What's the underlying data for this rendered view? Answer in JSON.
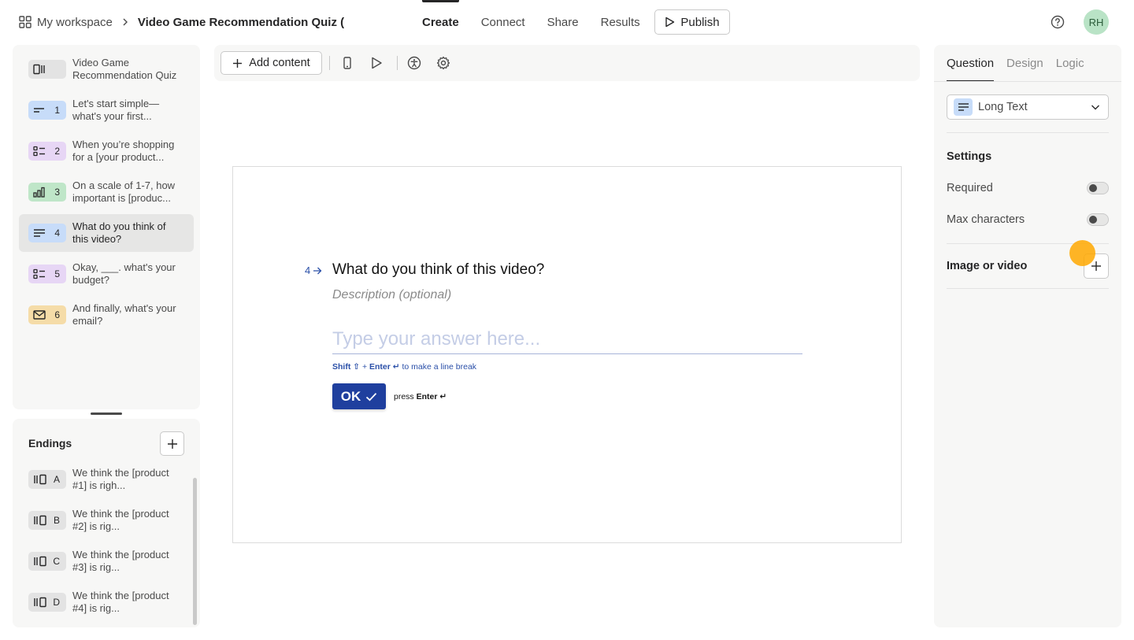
{
  "header": {
    "workspace": "My workspace",
    "form_title": "Video Game Recommendation Quiz (co",
    "tabs": [
      "Create",
      "Connect",
      "Share",
      "Results"
    ],
    "active_tab": "Create",
    "publish_label": "Publish",
    "avatar_initials": "RH"
  },
  "sidebar": {
    "questions": [
      {
        "kind": "welcome",
        "number": "",
        "text": "Video Game Recommendation Quiz",
        "color": "#e3e3e3"
      },
      {
        "kind": "short-text",
        "number": "1",
        "text": "Let's start simple—what's your first...",
        "color": "#c7dcf9"
      },
      {
        "kind": "multiple-choice",
        "number": "2",
        "text": "When you’re shopping for a [your product...",
        "color": "#e7d6f5"
      },
      {
        "kind": "opinion-scale",
        "number": "3",
        "text": "On a scale of 1-7, how important is [produc...",
        "color": "#bfe6c8"
      },
      {
        "kind": "long-text",
        "number": "4",
        "text": "What do you think of this video?",
        "color": "#c7dcf9"
      },
      {
        "kind": "multiple-choice",
        "number": "5",
        "text": "Okay, ___. what's your budget?",
        "color": "#e7d6f5"
      },
      {
        "kind": "email",
        "number": "6",
        "text": "And finally, what's your email?",
        "color": "#f5dca8"
      }
    ],
    "selected_index": 4,
    "endings_title": "Endings",
    "endings": [
      {
        "letter": "A",
        "text": "We think the [product #1] is righ..."
      },
      {
        "letter": "B",
        "text": "We think the [product #2] is rig..."
      },
      {
        "letter": "C",
        "text": "We think the [product #3] is rig..."
      },
      {
        "letter": "D",
        "text": "We think the [product #4] is rig..."
      }
    ]
  },
  "toolbar": {
    "add_content_label": "Add content"
  },
  "preview": {
    "question_number": "4",
    "question_title": "What do you think of this video?",
    "description_placeholder": "Description (optional)",
    "answer_placeholder": "Type your answer here...",
    "hint_shift": "Shift ⇧",
    "hint_plus": " + ",
    "hint_enter": "Enter ↵",
    "hint_rest": " to make a line break",
    "ok_label": "OK",
    "press_label": "press ",
    "press_enter": "Enter ↵",
    "accent": "#1f3f9e"
  },
  "panel": {
    "tabs": [
      "Question",
      "Design",
      "Logic"
    ],
    "active_tab": "Question",
    "question_type": "Long Text",
    "settings_heading": "Settings",
    "required_label": "Required",
    "required_on": false,
    "max_chars_label": "Max characters",
    "max_chars_on": false,
    "media_label": "Image or video"
  }
}
